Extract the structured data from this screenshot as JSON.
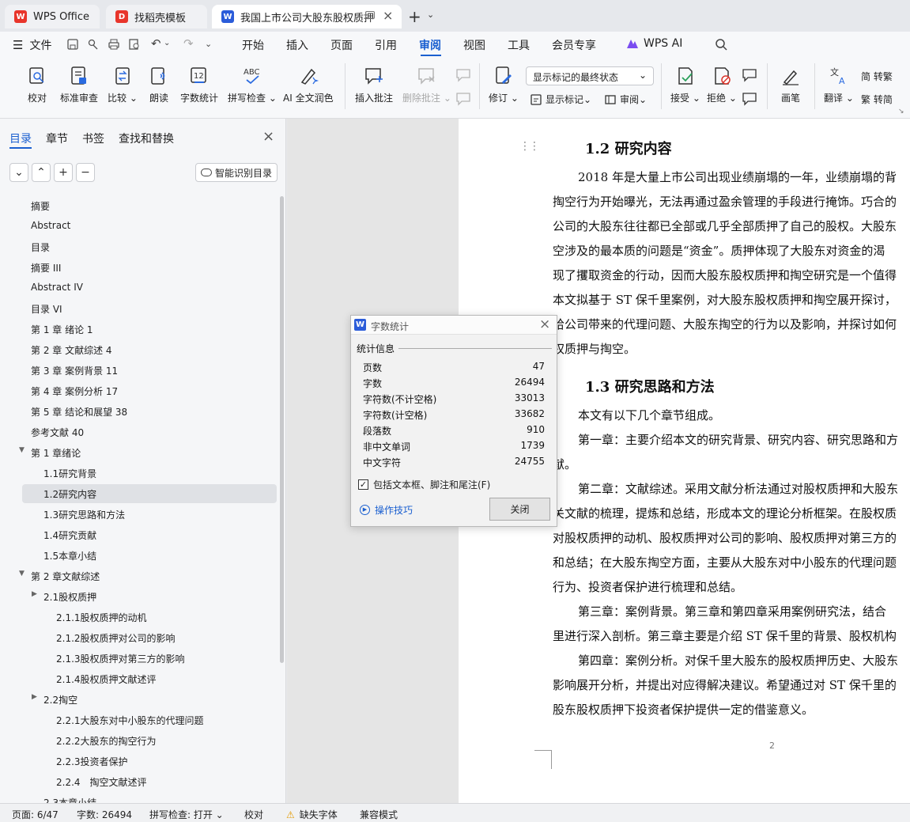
{
  "tabs": [
    {
      "label": "WPS Office"
    },
    {
      "label": "找稻壳模板"
    },
    {
      "label": "我国上市公司大股东股权质押"
    }
  ],
  "menubar": {
    "file": "文件",
    "items": [
      "开始",
      "插入",
      "页面",
      "引用",
      "审阅",
      "视图",
      "工具",
      "会员专享"
    ],
    "active": "审阅",
    "wps_ai": "WPS AI"
  },
  "ribbon": {
    "proofread": "校对",
    "standard_review": "标准审查",
    "compare": "比较",
    "read_aloud": "朗读",
    "word_count": "字数统计",
    "spell_check": "拼写检查",
    "ai_polish": "AI 全文润色",
    "insert_comment": "插入批注",
    "delete_comment": "删除批注",
    "revise": "修订",
    "markup_select": "显示标记的最终状态",
    "show_markup": "显示标记",
    "review": "审阅",
    "accept": "接受",
    "reject": "拒绝",
    "brush": "画笔",
    "translate": "翻译",
    "to_traditional": "简 转繁",
    "to_simplified": "繁 转简"
  },
  "sidebar": {
    "tabs": [
      "目录",
      "章节",
      "书签",
      "查找和替换"
    ],
    "smart_button": "智能识别目录",
    "toc": [
      {
        "text": "摘要",
        "level": 0
      },
      {
        "text": "Abstract",
        "level": 0
      },
      {
        "text": "目录",
        "level": 0
      },
      {
        "text": "摘要 III",
        "level": 0
      },
      {
        "text": "Abstract IV",
        "level": 0
      },
      {
        "text": "目录 VI",
        "level": 0
      },
      {
        "text": "第 1 章 绪论 1",
        "level": 0
      },
      {
        "text": "第 2 章 文献综述 4",
        "level": 0
      },
      {
        "text": "第 3 章 案例背景 11",
        "level": 0
      },
      {
        "text": "第 4 章 案例分析 17",
        "level": 0
      },
      {
        "text": "第 5 章 结论和展望 38",
        "level": 0
      },
      {
        "text": "参考文献 40",
        "level": 0
      },
      {
        "text": "第 1 章绪论",
        "level": 0,
        "arrow": "down"
      },
      {
        "text": "1.1研究背景",
        "level": 1
      },
      {
        "text": "1.2研究内容",
        "level": 1,
        "selected": true
      },
      {
        "text": "1.3研究思路和方法",
        "level": 1
      },
      {
        "text": "1.4研究贡献",
        "level": 1
      },
      {
        "text": "1.5本章小结",
        "level": 1
      },
      {
        "text": "第 2 章文献综述",
        "level": 0,
        "arrow": "down"
      },
      {
        "text": "2.1股权质押",
        "level": 1,
        "arrow": "right"
      },
      {
        "text": "2.1.1股权质押的动机",
        "level": 2
      },
      {
        "text": "2.1.2股权质押对公司的影响",
        "level": 2
      },
      {
        "text": "2.1.3股权质押对第三方的影响",
        "level": 2
      },
      {
        "text": "2.1.4股权质押文献述评",
        "level": 2
      },
      {
        "text": "2.2掏空",
        "level": 1,
        "arrow": "right"
      },
      {
        "text": "2.2.1大股东对中小股东的代理问题",
        "level": 2
      },
      {
        "text": "2.2.2大股东的掏空行为",
        "level": 2
      },
      {
        "text": "2.2.3投资者保护",
        "level": 2
      },
      {
        "text": "2.2.4　掏空文献述评",
        "level": 2
      },
      {
        "text": "2.3本章小结",
        "level": 1
      }
    ]
  },
  "document": {
    "lines": [
      {
        "t": "1.2  研究内容",
        "kind": "h"
      },
      {
        "t": "2018 年是大量上市公司出现业绩崩塌的一年，业绩崩塌的背",
        "kind": "p"
      },
      {
        "t": "掏空行为开始曝光，无法再通过盈余管理的手段进行掩饰。巧合的",
        "kind": "p"
      },
      {
        "t": "公司的大股东往往都已全部或几乎全部质押了自己的股权。大股东",
        "kind": "p"
      },
      {
        "t": "空涉及的最本质的问题是“资金”。质押体现了大股东对资金的渴",
        "kind": "p"
      },
      {
        "t": "现了攫取资金的行动，因而大股东股权质押和掏空研究是一个值得",
        "kind": "p"
      },
      {
        "t": "本文拟基于 ST 保千里案例，对大股东股权质押和掏空展开探讨，",
        "kind": "p"
      },
      {
        "t": "给公司带来的代理问题、大股东掏空的行为以及影响，并探讨如何",
        "kind": "p"
      },
      {
        "t": "权质押与掏空。",
        "kind": "p"
      },
      {
        "t": "1.3  研究思路和方法",
        "kind": "h"
      },
      {
        "t": "本文有以下几个章节组成。",
        "kind": "p"
      },
      {
        "t": "第一章：主要介绍本文的研究背景、研究内容、研究思路和方",
        "kind": "p"
      },
      {
        "t": "献。",
        "kind": "p"
      },
      {
        "t": "第二章：文献综述。采用文献分析法通过对股权质押和大股东",
        "kind": "p"
      },
      {
        "t": "关文献的梳理，提炼和总结，形成本文的理论分析框架。在股权质",
        "kind": "p"
      },
      {
        "t": "对股权质押的动机、股权质押对公司的影响、股权质押对第三方的",
        "kind": "p"
      },
      {
        "t": "和总结；在大股东掏空方面，主要从大股东对中小股东的代理问题",
        "kind": "p"
      },
      {
        "t": "行为、投资者保护进行梳理和总结。",
        "kind": "p"
      },
      {
        "t": "第三章：案例背景。第三章和第四章采用案例研究法，结合",
        "kind": "p"
      },
      {
        "t": "里进行深入剖析。第三章主要是介绍 ST 保千里的背景、股权机构",
        "kind": "p"
      },
      {
        "t": "第四章：案例分析。对保千里大股东的股权质押历史、大股东",
        "kind": "p"
      },
      {
        "t": "影响展开分析，并提出对应得解决建议。希望通过对 ST 保千里的",
        "kind": "p"
      },
      {
        "t": "股东股权质押下投资者保护提供一定的借鉴意义。",
        "kind": "p"
      }
    ],
    "page_number": "2"
  },
  "dialog": {
    "title": "字数统计",
    "section": "统计信息",
    "stats": [
      {
        "label": "页数",
        "value": "47"
      },
      {
        "label": "字数",
        "value": "26494"
      },
      {
        "label": "字符数(不计空格)",
        "value": "33013"
      },
      {
        "label": "字符数(计空格)",
        "value": "33682"
      },
      {
        "label": "段落数",
        "value": "910"
      },
      {
        "label": "非中文单词",
        "value": "1739"
      },
      {
        "label": "中文字符",
        "value": "24755"
      }
    ],
    "checkbox_label": "包括文本框、脚注和尾注(F)",
    "tips": "操作技巧",
    "close": "关闭"
  },
  "statusbar": {
    "page": "页面: 6/47",
    "words": "字数: 26494",
    "spell": "拼写检查: 打开",
    "proof": "校对",
    "missing_font": "缺失字体",
    "compat": "兼容模式"
  },
  "colors": {
    "accent": "#1a5fd0",
    "wps_red": "#e8352b",
    "selected_bg": "#dfe1e5"
  }
}
